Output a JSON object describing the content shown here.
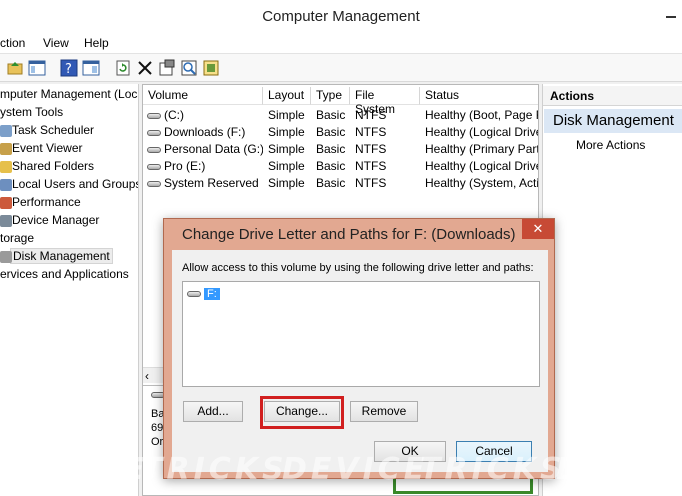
{
  "window": {
    "title": "Computer Management"
  },
  "menu": [
    "ction",
    "View",
    "Help"
  ],
  "toolbar": {
    "icons": [
      "folder-up-icon",
      "console-tree-icon",
      "help-icon",
      "show-hide-pane-icon",
      "refresh-icon",
      "delete-icon",
      "properties-icon",
      "search-icon",
      "export-icon"
    ]
  },
  "tree": {
    "items": [
      {
        "label": "mputer Management (Local",
        "icon": "computer-icon"
      },
      {
        "label": "ystem Tools",
        "icon": "tools-icon"
      },
      {
        "label": "Task Scheduler",
        "icon": "clock-icon"
      },
      {
        "label": "Event Viewer",
        "icon": "event-viewer-icon"
      },
      {
        "label": "Shared Folders",
        "icon": "shared-folder-icon"
      },
      {
        "label": "Local Users and Groups",
        "icon": "users-icon"
      },
      {
        "label": "Performance",
        "icon": "performance-icon"
      },
      {
        "label": "Device Manager",
        "icon": "device-manager-icon"
      },
      {
        "label": "torage",
        "icon": "storage-icon"
      },
      {
        "label": "Disk Management",
        "icon": "disk-icon"
      },
      {
        "label": "ervices and Applications",
        "icon": "services-icon"
      }
    ]
  },
  "volumes": {
    "columns": [
      "Volume",
      "Layout",
      "Type",
      "File System",
      "Status"
    ],
    "rows": [
      {
        "volume": "(C:)",
        "layout": "Simple",
        "type": "Basic",
        "fs": "NTFS",
        "status": "Healthy (Boot, Page F"
      },
      {
        "volume": "Downloads (F:)",
        "layout": "Simple",
        "type": "Basic",
        "fs": "NTFS",
        "status": "Healthy (Logical Drive"
      },
      {
        "volume": "Personal Data (G:)",
        "layout": "Simple",
        "type": "Basic",
        "fs": "NTFS",
        "status": "Healthy (Primary Part"
      },
      {
        "volume": "Pro (E:)",
        "layout": "Simple",
        "type": "Basic",
        "fs": "NTFS",
        "status": "Healthy (Logical Drive"
      },
      {
        "volume": "System Reserved",
        "layout": "Simple",
        "type": "Basic",
        "fs": "NTFS",
        "status": "Healthy (System, Acti"
      }
    ],
    "lower_info": [
      "Ba",
      "69",
      "Or"
    ]
  },
  "actions": {
    "header": "Actions",
    "section": "Disk Management",
    "more": "More Actions"
  },
  "dialog": {
    "title": "Change Drive Letter and Paths for F: (Downloads)",
    "close_label": "✕",
    "instruction": "Allow access to this volume by using the following drive letter and paths:",
    "entry": "F:",
    "add_label": "Add...",
    "change_label": "Change...",
    "remove_label": "Remove",
    "ok_label": "OK",
    "cancel_label": "Cancel"
  },
  "watermark": [
    "DEVICE",
    "TRICKS",
    "DEVICE",
    "TRICKS",
    "DEVICE"
  ]
}
